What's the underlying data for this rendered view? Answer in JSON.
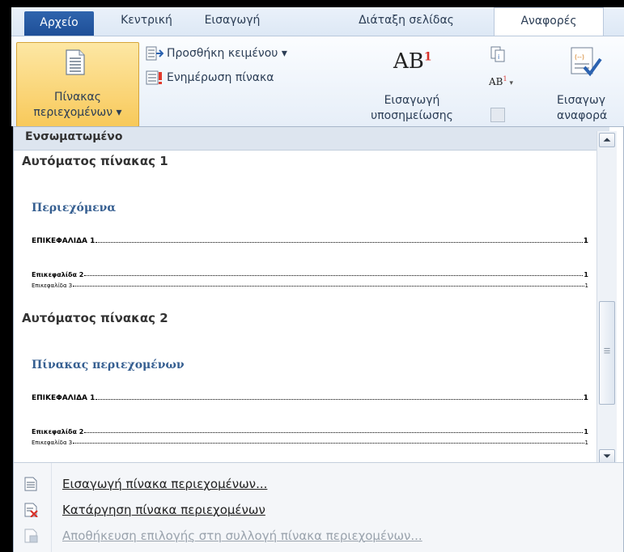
{
  "tabs": {
    "file": "Αρχείο",
    "home": "Κεντρική",
    "insert": "Εισαγωγή",
    "layout": "Διάταξη σελίδας",
    "references": "Αναφορές"
  },
  "ribbon": {
    "toc_label_line1": "Πίνακας",
    "toc_label_line2": "περιεχομένων ▾",
    "add_text": "Προσθήκη κειμένου ▾",
    "update_table": "Ενημέρωση πίνακα",
    "insert_footnote_icon_text": "AB",
    "insert_footnote_sup": "1",
    "insert_footnote_line1": "Εισαγωγή",
    "insert_footnote_line2": "υποσημείωσης",
    "insert_citation_line1": "Εισαγωγ",
    "insert_citation_line2": "αναφορά"
  },
  "gallery": {
    "header": "Ενσωματωμένο",
    "items": [
      {
        "title": "Αυτόματος πίνακας 1",
        "heading": "Περιεχόμενα",
        "lines": [
          {
            "text": "ΕΠΙΚΕΦΑΛΙΔΑ 1",
            "page": "1"
          },
          {
            "text": "Επικεφαλίδα 2",
            "page": "1"
          },
          {
            "text": "Επικεφαλίδα 3",
            "page": "1"
          }
        ]
      },
      {
        "title": "Αυτόματος πίνακας 2",
        "heading": "Πίνακας περιεχομένων",
        "lines": [
          {
            "text": "ΕΠΙΚΕΦΑΛΙΔΑ 1",
            "page": "1"
          },
          {
            "text": "Επικεφαλίδα 2",
            "page": "1"
          },
          {
            "text": "Επικεφαλίδα 3",
            "page": "1"
          }
        ]
      }
    ]
  },
  "menu": {
    "insert_toc": "Εισαγωγή πίνακα περιεχομένων...",
    "remove_toc": "Κατάργηση πίνακα περιεχομένων",
    "save_selection": "Αποθήκευση επιλογής στη συλλογή πίνακα περιεχομένων..."
  },
  "colors": {
    "file_tab": "#2f64ad",
    "toc_button_highlight": "#f8c95a",
    "toc_heading": "#365f91",
    "remove_icon_red": "#d8312a"
  }
}
